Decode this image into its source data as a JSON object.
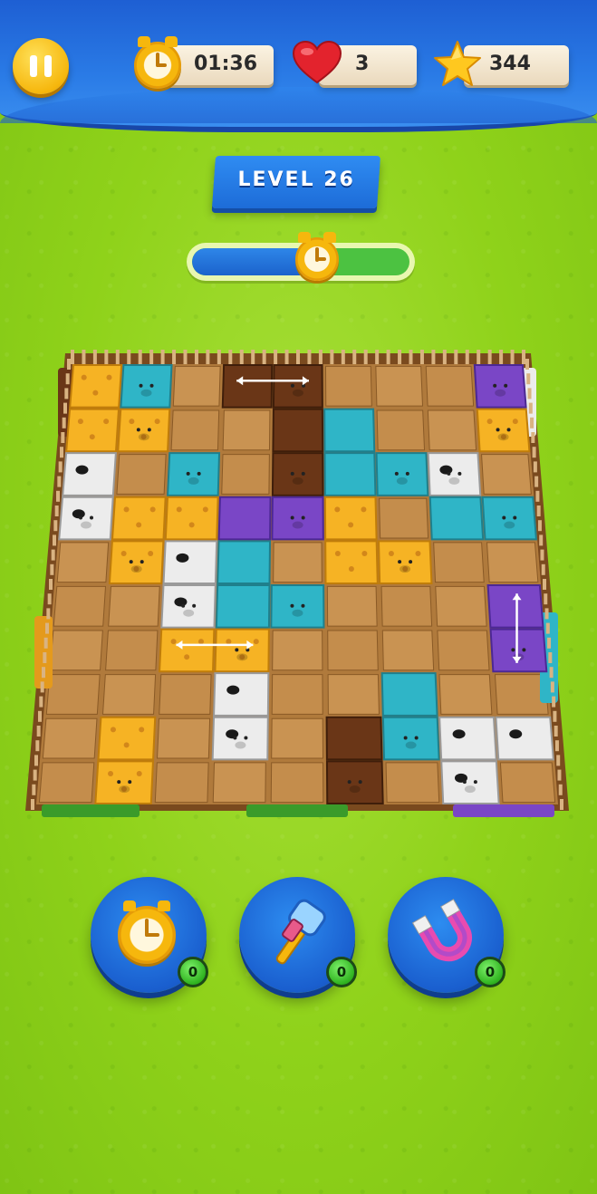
{
  "hud": {
    "timer": "01:36",
    "lives": "3",
    "stars": "344"
  },
  "level": {
    "label": "LEVEL 26"
  },
  "progress": {
    "fill_fraction": 0.6
  },
  "boosters": [
    {
      "name": "time-freeze",
      "count": "0"
    },
    {
      "name": "hammer",
      "count": "0"
    },
    {
      "name": "magnet",
      "count": "0"
    }
  ],
  "colors": {
    "grass": "#8fd21a",
    "top_bar": "#2a7be6",
    "giraffe": "#f6b324",
    "hippo": "#2fb5c7",
    "rhino": "#7a46c6",
    "bear": "#6a3617",
    "cow": "#ececec",
    "board": "#b07a3c"
  },
  "pieces": [
    {
      "animal": "giraffe",
      "cells": [
        [
          0,
          0
        ],
        [
          0,
          1
        ],
        [
          1,
          1
        ]
      ]
    },
    {
      "animal": "hippo",
      "cells": [
        [
          1,
          0
        ]
      ]
    },
    {
      "animal": "bear",
      "cells": [
        [
          3,
          0
        ],
        [
          4,
          0
        ]
      ],
      "arrow": "horizontal"
    },
    {
      "animal": "rhino",
      "cells": [
        [
          8,
          0
        ]
      ]
    },
    {
      "animal": "giraffe",
      "cells": [
        [
          8,
          1
        ]
      ]
    },
    {
      "animal": "bear",
      "cells": [
        [
          4,
          1
        ],
        [
          4,
          2
        ]
      ]
    },
    {
      "animal": "hippo",
      "cells": [
        [
          5,
          1
        ],
        [
          5,
          2
        ],
        [
          6,
          2
        ]
      ]
    },
    {
      "animal": "cow",
      "cells": [
        [
          0,
          2
        ],
        [
          0,
          3
        ]
      ]
    },
    {
      "animal": "hippo",
      "cells": [
        [
          2,
          2
        ]
      ]
    },
    {
      "animal": "cow",
      "cells": [
        [
          7,
          2
        ]
      ]
    },
    {
      "animal": "giraffe",
      "cells": [
        [
          1,
          3
        ],
        [
          2,
          3
        ],
        [
          3,
          3
        ]
      ]
    },
    {
      "animal": "rhino",
      "cells": [
        [
          3,
          3
        ],
        [
          4,
          3
        ]
      ]
    },
    {
      "animal": "giraffe",
      "cells": [
        [
          5,
          3
        ],
        [
          5,
          4
        ],
        [
          6,
          4
        ]
      ]
    },
    {
      "animal": "hippo",
      "cells": [
        [
          7,
          3
        ],
        [
          8,
          3
        ]
      ]
    },
    {
      "animal": "giraffe",
      "cells": [
        [
          1,
          4
        ]
      ]
    },
    {
      "animal": "cow",
      "cells": [
        [
          2,
          4
        ],
        [
          2,
          5
        ]
      ]
    },
    {
      "animal": "hippo",
      "cells": [
        [
          3,
          4
        ],
        [
          3,
          5
        ],
        [
          4,
          5
        ]
      ]
    },
    {
      "animal": "rhino",
      "cells": [
        [
          8,
          5
        ],
        [
          8,
          6
        ]
      ],
      "arrow": "vertical"
    },
    {
      "animal": "giraffe",
      "cells": [
        [
          2,
          6
        ],
        [
          3,
          6
        ]
      ],
      "arrow": "horizontal"
    },
    {
      "animal": "cow",
      "cells": [
        [
          3,
          7
        ],
        [
          3,
          8
        ]
      ]
    },
    {
      "animal": "hippo",
      "cells": [
        [
          6,
          7
        ],
        [
          6,
          8
        ]
      ]
    },
    {
      "animal": "cow",
      "cells": [
        [
          7,
          8
        ],
        [
          8,
          8
        ],
        [
          7,
          9
        ]
      ]
    },
    {
      "animal": "giraffe",
      "cells": [
        [
          1,
          8
        ],
        [
          1,
          9
        ]
      ]
    },
    {
      "animal": "bear",
      "cells": [
        [
          5,
          8
        ],
        [
          5,
          9
        ]
      ]
    }
  ]
}
